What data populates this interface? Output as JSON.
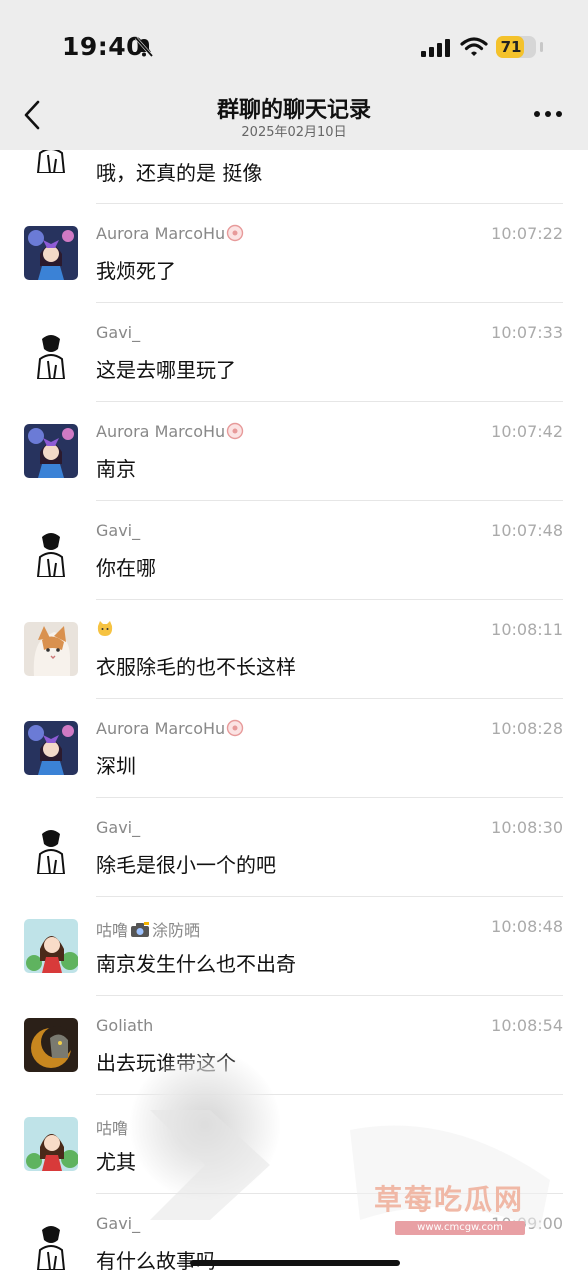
{
  "status_bar": {
    "time": "19:40",
    "battery": "71",
    "battery_level": 0.71
  },
  "nav": {
    "title": "群聊的聊天记录",
    "subtitle": "2025年02月10日"
  },
  "colors": {
    "topbar_bg": "#ededed",
    "battery": "#f4c22b",
    "divider": "#e6e6e6",
    "watermark": "#f0b8a6"
  },
  "first_text": "哦，还真的是 挺像",
  "messages": [
    {
      "sender": "Aurora MarcoHu",
      "badge": "flower-icon",
      "time": "10:07:22",
      "text": "我烦死了",
      "avatar": "anime-girl"
    },
    {
      "sender": "Gavi_",
      "time": "10:07:33",
      "text": "这是去哪里玩了",
      "avatar": "man-sketch"
    },
    {
      "sender": "Aurora MarcoHu",
      "badge": "flower-icon",
      "time": "10:07:42",
      "text": "南京",
      "avatar": "anime-girl"
    },
    {
      "sender": "Gavi_",
      "time": "10:07:48",
      "text": "你在哪",
      "avatar": "man-sketch"
    },
    {
      "sender": "",
      "sender_emoji": "cat-emoji",
      "time": "10:08:11",
      "text": "衣服除毛的也不长这样",
      "avatar": "cat-photo"
    },
    {
      "sender": "Aurora MarcoHu",
      "badge": "flower-icon",
      "time": "10:08:28",
      "text": "深圳",
      "avatar": "anime-girl"
    },
    {
      "sender": "Gavi_",
      "time": "10:08:30",
      "text": "除毛是很小一个的吧",
      "avatar": "man-sketch"
    },
    {
      "sender_part1": "咕噜",
      "sender_part2": "涂防晒",
      "sender_emoji": "camera-emoji",
      "time": "10:08:48",
      "text": "南京发生什么也不出奇",
      "avatar": "cartoon-girl"
    },
    {
      "sender": "Goliath",
      "time": "10:08:54",
      "text": "出去玩谁带这个",
      "avatar": "dark-avatar"
    },
    {
      "sender": "咕噜",
      "time": "",
      "text": "尤其",
      "avatar": "cartoon-girl"
    },
    {
      "sender": "Gavi_",
      "time": "10:09:00",
      "text": "有什么故事吗",
      "avatar": "man-sketch"
    }
  ],
  "watermark": {
    "text": "草莓吃瓜网",
    "url": "www.cmcgw.com"
  }
}
